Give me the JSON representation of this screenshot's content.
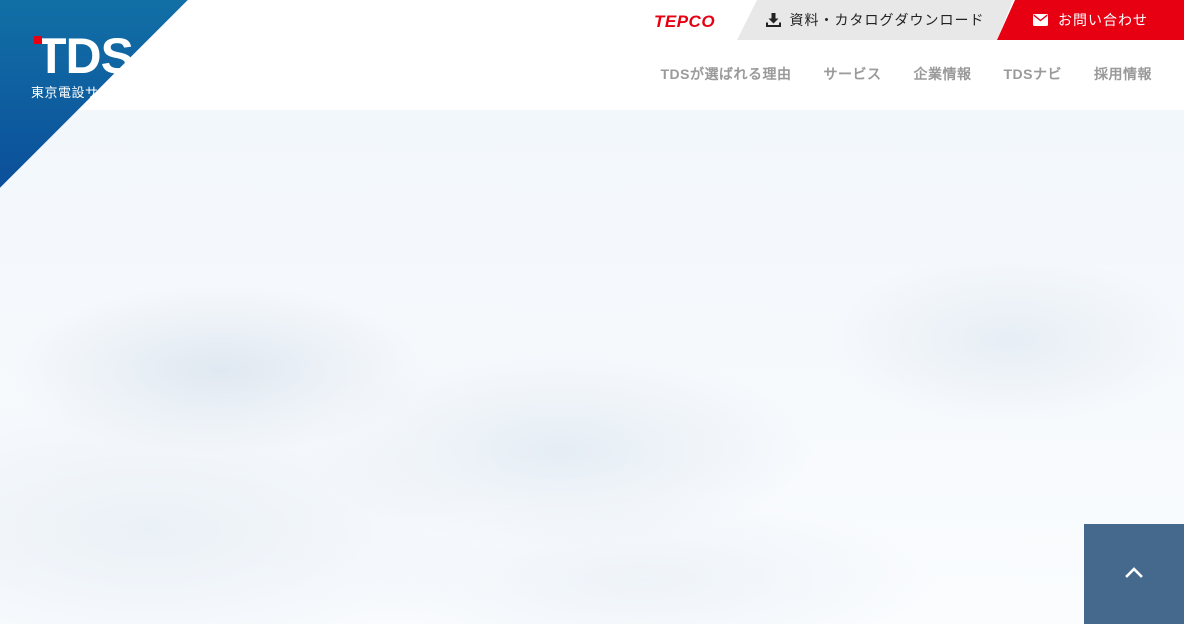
{
  "logo": {
    "mark": "TDS",
    "subtitle": "東京電設サービス"
  },
  "header": {
    "tepco": "TEPCO",
    "download": {
      "label": "資料・カタログダウンロード",
      "icon": "download-icon"
    },
    "contact": {
      "label": "お問い合わせ",
      "icon": "mail-icon"
    }
  },
  "nav": {
    "items": [
      {
        "label": "TDSが選ばれる理由"
      },
      {
        "label": "サービス"
      },
      {
        "label": "企業情報"
      },
      {
        "label": "TDSナビ"
      },
      {
        "label": "採用情報"
      }
    ]
  },
  "to_top": {
    "icon": "chevron-up-icon"
  },
  "colors": {
    "brand_red": "#e60012",
    "brand_blue": "#0b4f9a",
    "to_top_bg": "#45688d"
  }
}
